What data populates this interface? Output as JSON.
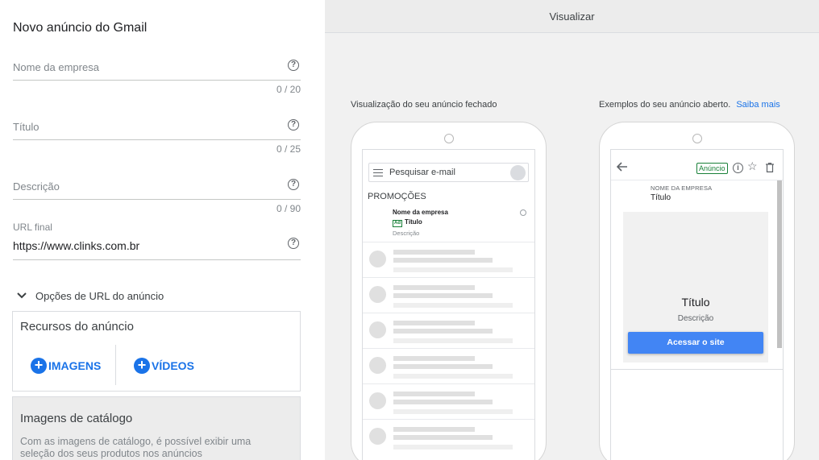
{
  "form": {
    "title": "Novo anúncio do Gmail",
    "fields": [
      {
        "label": "Nome da empresa",
        "counter": "0 / 20"
      },
      {
        "label": "Título",
        "counter": "0 / 25"
      },
      {
        "label": "Descrição",
        "counter": "0 / 90"
      }
    ],
    "url": {
      "label": "URL final",
      "value": "https://www.clinks.com.br"
    },
    "url_options_label": "Opções de URL do anúncio",
    "resources": {
      "title": "Recursos do anúncio",
      "images_label": "IMAGENS",
      "videos_label": "VÍDEOS"
    },
    "catalog": {
      "title": "Imagens de catálogo",
      "description": "Com as imagens de catálogo, é possível exibir uma seleção dos seus produtos nos anúncios"
    }
  },
  "preview": {
    "header": "Visualizar",
    "collapsed_caption": "Visualização do seu anúncio fechado",
    "expanded_caption": "Exemplos do seu anúncio aberto.",
    "learn_more": "Saiba mais",
    "inbox": {
      "search_placeholder": "Pesquisar e-mail",
      "section": "PROMOÇÕES",
      "ad_name": "Nome da empresa",
      "ad_badge": "Ad",
      "ad_title": "Título",
      "ad_description": "Descrição"
    },
    "expanded": {
      "badge": "Anúncio",
      "company": "NOME DA EMPRESA",
      "title": "Título",
      "card_title": "Título",
      "card_description": "Descrição",
      "cta": "Acessar o site"
    }
  },
  "colors": {
    "accent": "#1a73e8",
    "cta": "#4285f4",
    "ad_badge": "#188038"
  }
}
